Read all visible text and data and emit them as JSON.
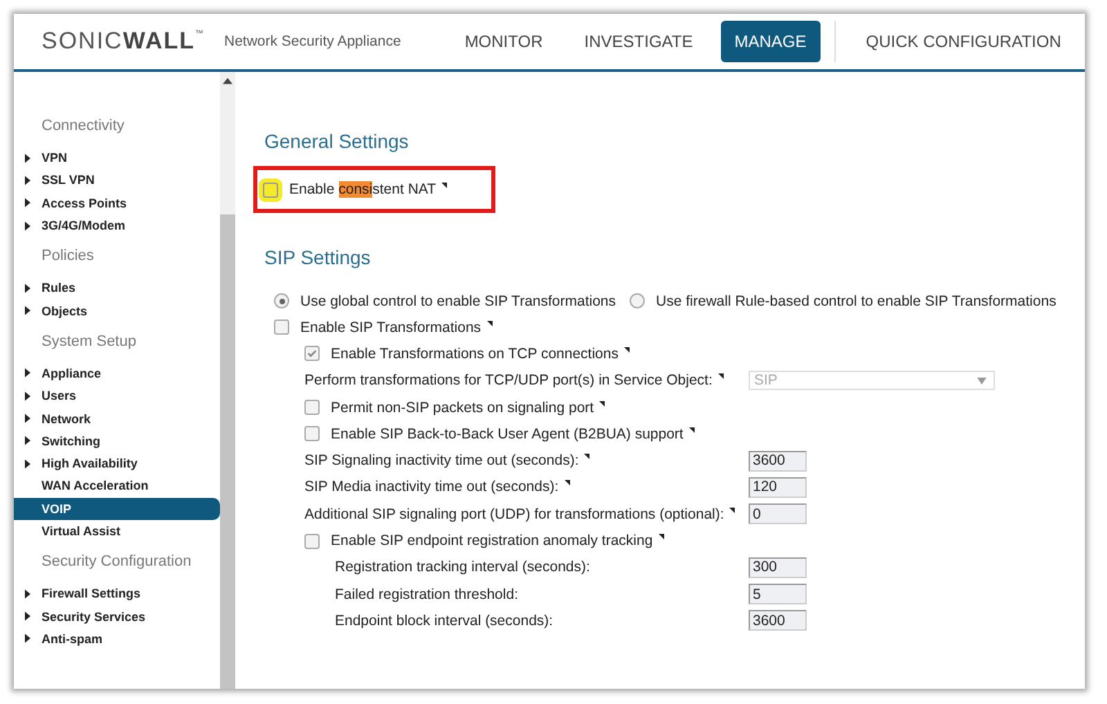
{
  "header": {
    "logo_light": "SONIC",
    "logo_bold": "WALL",
    "logo_mark": "™",
    "product": "Network Security Appliance",
    "nav": [
      {
        "label": "MONITOR",
        "selected": false
      },
      {
        "label": "INVESTIGATE",
        "selected": false
      },
      {
        "label": "MANAGE",
        "selected": true
      },
      {
        "label": "QUICK CONFIGURATION",
        "selected": false
      }
    ]
  },
  "sidebar": {
    "groups": [
      {
        "title": "Connectivity",
        "items": [
          {
            "label": "VPN",
            "expandable": true,
            "selected": false
          },
          {
            "label": "SSL VPN",
            "expandable": true,
            "selected": false
          },
          {
            "label": "Access Points",
            "expandable": true,
            "selected": false
          },
          {
            "label": "3G/4G/Modem",
            "expandable": true,
            "selected": false
          }
        ]
      },
      {
        "title": "Policies",
        "items": [
          {
            "label": "Rules",
            "expandable": true,
            "selected": false
          },
          {
            "label": "Objects",
            "expandable": true,
            "selected": false
          }
        ]
      },
      {
        "title": "System Setup",
        "items": [
          {
            "label": "Appliance",
            "expandable": true,
            "selected": false
          },
          {
            "label": "Users",
            "expandable": true,
            "selected": false
          },
          {
            "label": "Network",
            "expandable": true,
            "selected": false
          },
          {
            "label": "Switching",
            "expandable": true,
            "selected": false
          },
          {
            "label": "High Availability",
            "expandable": true,
            "selected": false
          },
          {
            "label": "WAN Acceleration",
            "expandable": false,
            "selected": false
          },
          {
            "label": "VOIP",
            "expandable": false,
            "selected": true
          },
          {
            "label": "Virtual Assist",
            "expandable": false,
            "selected": false
          }
        ]
      },
      {
        "title": "Security Configuration",
        "items": [
          {
            "label": "Firewall Settings",
            "expandable": true,
            "selected": false
          },
          {
            "label": "Security Services",
            "expandable": true,
            "selected": false
          },
          {
            "label": "Anti-spam",
            "expandable": true,
            "selected": false
          }
        ]
      }
    ]
  },
  "general": {
    "title": "General Settings",
    "option": {
      "label_before": "Enable ",
      "label_marked": "consi",
      "label_after": "stent NAT",
      "checked": false,
      "help": true,
      "annotated": true
    }
  },
  "sip": {
    "title": "SIP Settings",
    "radios": [
      {
        "label": "Use global control to enable SIP Transformations",
        "selected": true
      },
      {
        "label": "Use firewall Rule-based control to enable SIP Transformations",
        "selected": false
      }
    ],
    "rows": [
      {
        "kind": "checkbox",
        "label": "Enable SIP Transformations",
        "checked": false,
        "help": true,
        "children": [
          {
            "kind": "checkbox",
            "label": "Enable Transformations on TCP connections",
            "checked": true,
            "help": true
          },
          {
            "kind": "select",
            "label": "Perform transformations for TCP/UDP port(s) in Service Object:",
            "value": "SIP",
            "help": true
          },
          {
            "kind": "checkbox",
            "label": "Permit non-SIP packets on signaling port",
            "checked": false,
            "help": true
          },
          {
            "kind": "checkbox",
            "label": "Enable SIP Back-to-Back User Agent (B2BUA) support",
            "checked": false,
            "help": true
          },
          {
            "kind": "number",
            "label": "SIP Signaling inactivity time out (seconds):",
            "value": "3600",
            "help": true
          },
          {
            "kind": "number",
            "label": "SIP Media inactivity time out (seconds):",
            "value": "120",
            "help": true
          },
          {
            "kind": "number",
            "label": "Additional SIP signaling port (UDP) for transformations (optional):",
            "value": "0",
            "help": true
          },
          {
            "kind": "checkbox",
            "label": "Enable SIP endpoint registration anomaly tracking",
            "checked": false,
            "help": true,
            "children": [
              {
                "kind": "number",
                "label": "Registration tracking interval (seconds):",
                "value": "300",
                "help": false
              },
              {
                "kind": "number",
                "label": "Failed registration threshold:",
                "value": "5",
                "help": false
              },
              {
                "kind": "number",
                "label": "Endpoint block interval (seconds):",
                "value": "3600",
                "help": false
              }
            ]
          }
        ]
      }
    ]
  }
}
